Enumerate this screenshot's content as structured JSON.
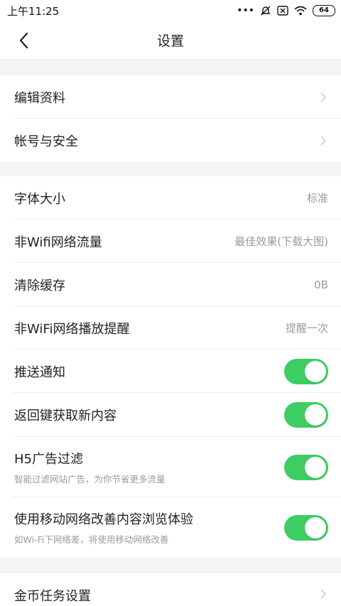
{
  "status_bar": {
    "time": "上午11:25",
    "dots": "•••",
    "battery": "64"
  },
  "nav": {
    "title": "设置"
  },
  "rows": {
    "edit_profile": "编辑资料",
    "account_security": "帐号与安全",
    "font_size": {
      "label": "字体大小",
      "value": "标准"
    },
    "non_wifi_traffic": {
      "label": "非Wifi网络流量",
      "value": "最佳效果(下载大图)"
    },
    "clear_cache": {
      "label": "清除缓存",
      "value": "0B"
    },
    "non_wifi_play": {
      "label": "非WiFi网络播放提醒",
      "value": "提醒一次"
    },
    "push_notify": {
      "label": "推送通知",
      "on": true
    },
    "back_refresh": {
      "label": "返回键获取新内容",
      "on": true
    },
    "h5_filter": {
      "label": "H5广告过滤",
      "sub": "智能过滤网站广告，为你节省更多流量",
      "on": true
    },
    "mobile_improve": {
      "label": "使用移动网络改善内容浏览体验",
      "sub": "如Wi-Fi下网络差，将使用移动网络改善",
      "on": true
    },
    "coin_task": "金币任务设置"
  },
  "colors": {
    "toggle_on": "#3ecd63",
    "section_gap": "#f4f4f4"
  }
}
